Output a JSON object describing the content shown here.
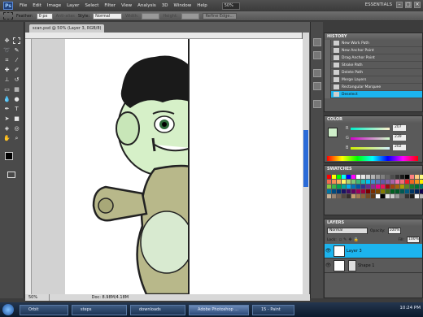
{
  "app": {
    "menu": [
      "File",
      "Edit",
      "Image",
      "Layer",
      "Select",
      "Filter",
      "View",
      "Analysis",
      "3D",
      "Window",
      "Help"
    ],
    "zoom_box": "50%",
    "workspace": "ESSENTIALS"
  },
  "options_bar": {
    "feather_label": "Feather:",
    "feather_value": "0 px",
    "anti_alias": "Anti-alias",
    "style_label": "Style:",
    "style_value": "Normal",
    "width_label": "Width:",
    "height_label": "Height:",
    "refine_edge": "Refine Edge..."
  },
  "document": {
    "tab_title": "scan.psd @ 50% (Layer 3, RGB/8) *",
    "zoom": "50%",
    "doc_size": "Doc: 8.98M/4.18M"
  },
  "history": {
    "title": "HISTORY",
    "items": [
      "New Work Path",
      "New Anchor Point",
      "Drag Anchor Point",
      "Stroke Path",
      "Delete Path",
      "Merge Layers",
      "Rectangular Marquee",
      "Deselect"
    ]
  },
  "color": {
    "title": "COLOR",
    "r_label": "R",
    "r_value": "207",
    "g_label": "G",
    "g_value": "239",
    "b_label": "B",
    "b_value": "202"
  },
  "swatches": {
    "title": "SWATCHES",
    "colors": [
      "#ff0000",
      "#ffff00",
      "#00ff00",
      "#00ffff",
      "#0000ff",
      "#ff00ff",
      "#ffffff",
      "#e6e6e6",
      "#cccccc",
      "#b3b3b3",
      "#999999",
      "#808080",
      "#666666",
      "#4d4d4d",
      "#333333",
      "#1a1a1a",
      "#000000",
      "#ff8080",
      "#ffcc80",
      "#ffff80",
      "#f26c4f",
      "#f68e55",
      "#fbaf5c",
      "#fff467",
      "#acd372",
      "#7cc576",
      "#3bb878",
      "#1abbb4",
      "#00bff3",
      "#438cca",
      "#5574b9",
      "#605ca8",
      "#855fa8",
      "#a763a8",
      "#f06ea9",
      "#f26d7d",
      "#ed1c24",
      "#f26522",
      "#f7941d",
      "#fff200",
      "#8dc73f",
      "#39b54a",
      "#00a651",
      "#00a99d",
      "#00aeef",
      "#0072bc",
      "#0054a6",
      "#2e3192",
      "#662d91",
      "#92278f",
      "#ec008c",
      "#ed145b",
      "#9e0b0f",
      "#a0410d",
      "#a36209",
      "#aba000",
      "#598527",
      "#1a7b30",
      "#007236",
      "#00746b",
      "#0076a3",
      "#004b80",
      "#003471",
      "#1b1464",
      "#440e62",
      "#630460",
      "#9e005d",
      "#9e0039",
      "#790000",
      "#7b2e00",
      "#7d4900",
      "#827b00",
      "#406618",
      "#005e20",
      "#005826",
      "#005952",
      "#005b7f",
      "#003663",
      "#002157",
      "#0d004c",
      "#c7b299",
      "#998675",
      "#736357",
      "#534741",
      "#37302d",
      "#c69c6d",
      "#a67c52",
      "#8c6239",
      "#754c24",
      "#603913",
      "#ffffff",
      "#000000",
      "#e6e6e6",
      "#cccccc",
      "#999999",
      "#666666",
      "#333333",
      "#1a1a1a",
      "#f2f2f2",
      "#b3b3b3"
    ]
  },
  "layers": {
    "title": "LAYERS",
    "blend_mode": "Normal",
    "opacity_label": "Opacity:",
    "opacity_value": "100%",
    "lock_label": "Lock:",
    "fill_label": "Fill:",
    "fill_value": "100%",
    "items": [
      "Layer 3",
      "Shape 1"
    ]
  },
  "taskbar": {
    "tasks": [
      "Orbit",
      "steps",
      "downloads",
      "Adobe Photoshop ...",
      "15 - Paint"
    ],
    "clock": "10:24 PM"
  },
  "colors": {
    "accent": "#1cb4ee",
    "skin": "#d6f0c8",
    "hair": "#1a1a1a",
    "body": "#b8b88a"
  }
}
